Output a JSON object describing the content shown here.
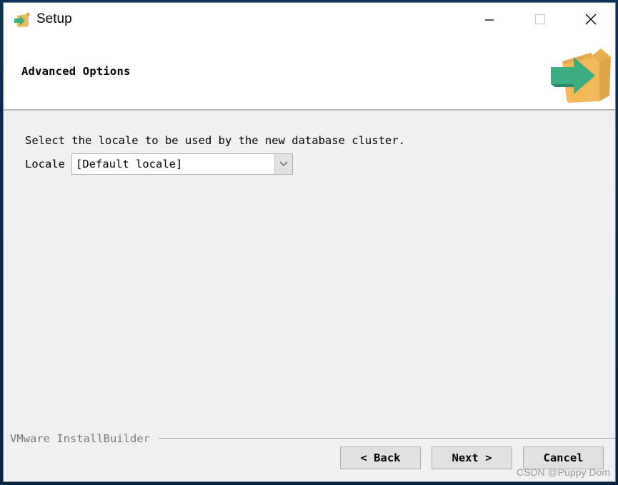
{
  "window": {
    "title": "Setup",
    "controls": {
      "minimize": "minimize-icon",
      "maximize": "maximize-icon",
      "close": "close-icon"
    }
  },
  "header": {
    "title": "Advanced Options",
    "logo_icon": "installer-box-arrow-icon"
  },
  "content": {
    "instruction": "Select the locale to be used by the new database cluster.",
    "locale_label": "Locale",
    "locale_value": "[Default locale]",
    "locale_dropdown_icon": "chevron-down-icon"
  },
  "footer": {
    "brand": "VMware InstallBuilder",
    "buttons": {
      "back": "< Back",
      "next": "Next >",
      "cancel": "Cancel"
    },
    "watermark": "CSDN @Puppy Dom"
  },
  "colors": {
    "box_orange": "#f2b95a",
    "box_orange_dark": "#e0a448",
    "arrow_green": "#3dae82",
    "window_bg": "#f0f0f0"
  }
}
